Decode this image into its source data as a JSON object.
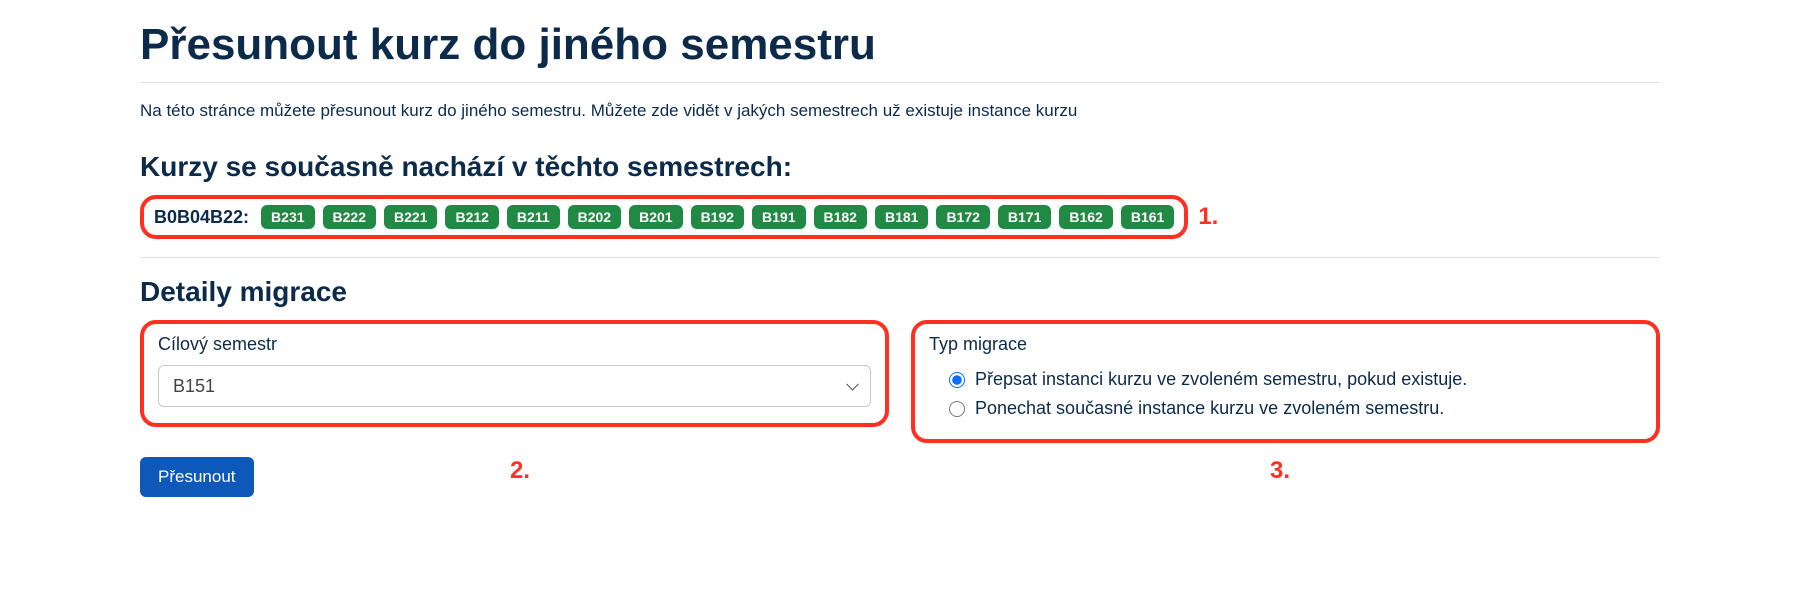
{
  "page_title": "Přesunout kurz do jiného semestru",
  "intro_text": "Na této stránce můžete přesunout kurz do jiného semestru. Můžete zde vidět v jakých semestrech už existuje instance kurzu",
  "current_heading": "Kurzy se současně nachází v těchto semestrech:",
  "course_code_label": "B0B04B22:",
  "semesters": [
    "B231",
    "B222",
    "B221",
    "B212",
    "B211",
    "B202",
    "B201",
    "B192",
    "B191",
    "B182",
    "B181",
    "B172",
    "B171",
    "B162",
    "B161"
  ],
  "annotation_1": "1.",
  "details_heading": "Detaily migrace",
  "target_semester_label": "Cílový semestr",
  "target_semester_value": "B151",
  "migration_type_label": "Typ migrace",
  "migration_options": {
    "overwrite": "Přepsat instanci kurzu ve zvoleném semestru, pokud existuje.",
    "keep": "Ponechat současné instance kurzu ve zvoleném semestru."
  },
  "annotation_2": "2.",
  "annotation_3": "3.",
  "submit_label": "Přesunout"
}
